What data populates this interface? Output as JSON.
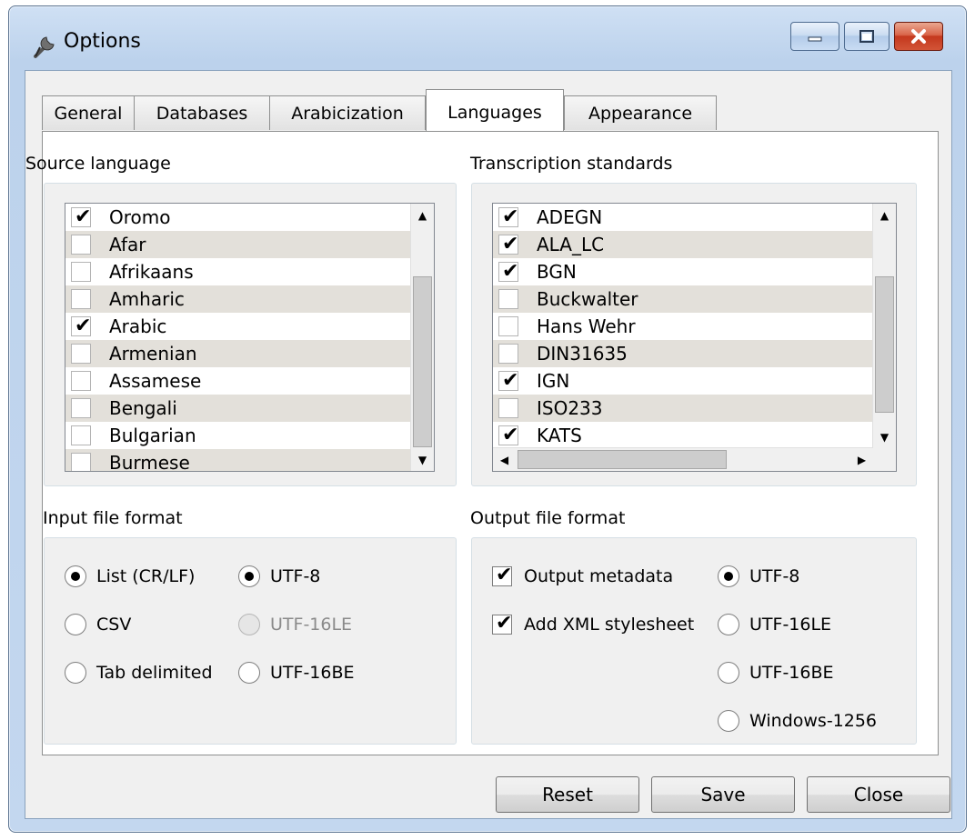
{
  "window": {
    "title": "Options",
    "icon": "wrench-icon"
  },
  "tabs": [
    {
      "label": "General"
    },
    {
      "label": "Databases"
    },
    {
      "label": "Arabicization"
    },
    {
      "label": "Languages"
    },
    {
      "label": "Appearance"
    }
  ],
  "active_tab": "Languages",
  "source_language": {
    "label": "Source language",
    "items": [
      {
        "label": "Oromo",
        "checked": true
      },
      {
        "label": "Afar",
        "checked": false
      },
      {
        "label": "Afrikaans",
        "checked": false
      },
      {
        "label": "Amharic",
        "checked": false
      },
      {
        "label": "Arabic",
        "checked": true
      },
      {
        "label": "Armenian",
        "checked": false
      },
      {
        "label": "Assamese",
        "checked": false
      },
      {
        "label": "Bengali",
        "checked": false
      },
      {
        "label": "Bulgarian",
        "checked": false
      },
      {
        "label": "Burmese",
        "checked": false
      }
    ]
  },
  "transcription_standards": {
    "label": "Transcription standards",
    "items": [
      {
        "label": "ADEGN",
        "checked": true
      },
      {
        "label": "ALA_LC",
        "checked": true
      },
      {
        "label": "BGN",
        "checked": true
      },
      {
        "label": "Buckwalter",
        "checked": false
      },
      {
        "label": "Hans Wehr",
        "checked": false
      },
      {
        "label": "DIN31635",
        "checked": false
      },
      {
        "label": "IGN",
        "checked": true
      },
      {
        "label": "ISO233",
        "checked": false
      },
      {
        "label": "KATS",
        "checked": true
      }
    ]
  },
  "input_format": {
    "label": "Input file format",
    "types": [
      {
        "label": "List (CR/LF)",
        "selected": true
      },
      {
        "label": "CSV",
        "selected": false
      },
      {
        "label": "Tab delimited",
        "selected": false
      }
    ],
    "encodings": [
      {
        "label": "UTF-8",
        "selected": true,
        "enabled": true
      },
      {
        "label": "UTF-16LE",
        "selected": false,
        "enabled": false
      },
      {
        "label": "UTF-16BE",
        "selected": false,
        "enabled": true
      }
    ]
  },
  "output_format": {
    "label": "Output file format",
    "options": [
      {
        "label": "Output metadata",
        "checked": true
      },
      {
        "label": "Add XML stylesheet",
        "checked": true
      }
    ],
    "encodings": [
      {
        "label": "UTF-8",
        "selected": true
      },
      {
        "label": "UTF-16LE",
        "selected": false
      },
      {
        "label": "UTF-16BE",
        "selected": false
      },
      {
        "label": "Windows-1256",
        "selected": false
      }
    ]
  },
  "buttons": {
    "reset": "Reset",
    "save": "Save",
    "close": "Close"
  }
}
